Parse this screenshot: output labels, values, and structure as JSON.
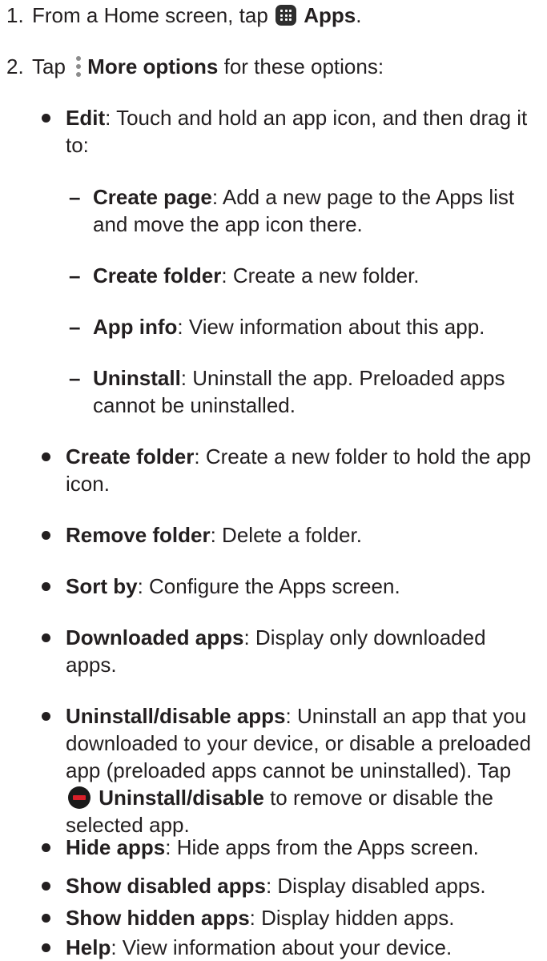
{
  "steps": [
    {
      "number": "1.",
      "prefix": "From a Home screen, tap",
      "icon": "apps-grid-icon",
      "bold": "Apps",
      "suffix": "."
    },
    {
      "number": "2.",
      "prefix": "Tap",
      "icon": "more-options-icon",
      "bold": "More options",
      "suffix": "for these options:"
    }
  ],
  "options": [
    {
      "term": "Edit",
      "desc": ": Touch and hold an app icon, and then drag it to:"
    },
    {
      "term": "Create folder",
      "desc": ": Create a new folder to hold the app icon."
    },
    {
      "term": "Remove folder",
      "desc": ": Delete a folder."
    },
    {
      "term": "Sort by",
      "desc": ": Configure the Apps screen."
    },
    {
      "term": "Downloaded apps",
      "desc": ": Display only downloaded apps."
    },
    {
      "term": "Uninstall/disable apps",
      "desc": ": Uninstall an app that you downloaded to your device, or disable a preloaded app (preloaded apps cannot be uninstalled). Tap",
      "icon": "uninstall-disable-icon",
      "term2": "Uninstall/disable",
      "desc2": "to remove or disable the selected app."
    },
    {
      "term": "Hide apps",
      "desc": ": Hide apps from the Apps screen."
    },
    {
      "term": "Show disabled apps",
      "desc": ": Display disabled apps."
    },
    {
      "term": "Show hidden apps",
      "desc": ": Display hidden apps."
    },
    {
      "term": "Help",
      "desc": ": View information about your device."
    }
  ],
  "edit_suboptions": [
    {
      "term": "Create page",
      "desc": ": Add a new page to the Apps list and move the app icon there."
    },
    {
      "term": "Create folder",
      "desc": ": Create a new folder."
    },
    {
      "term": "App info",
      "desc": ": View information about this app."
    },
    {
      "term": "Uninstall",
      "desc": ": Uninstall the app. Preloaded apps cannot be uninstalled."
    }
  ],
  "dash": "–"
}
